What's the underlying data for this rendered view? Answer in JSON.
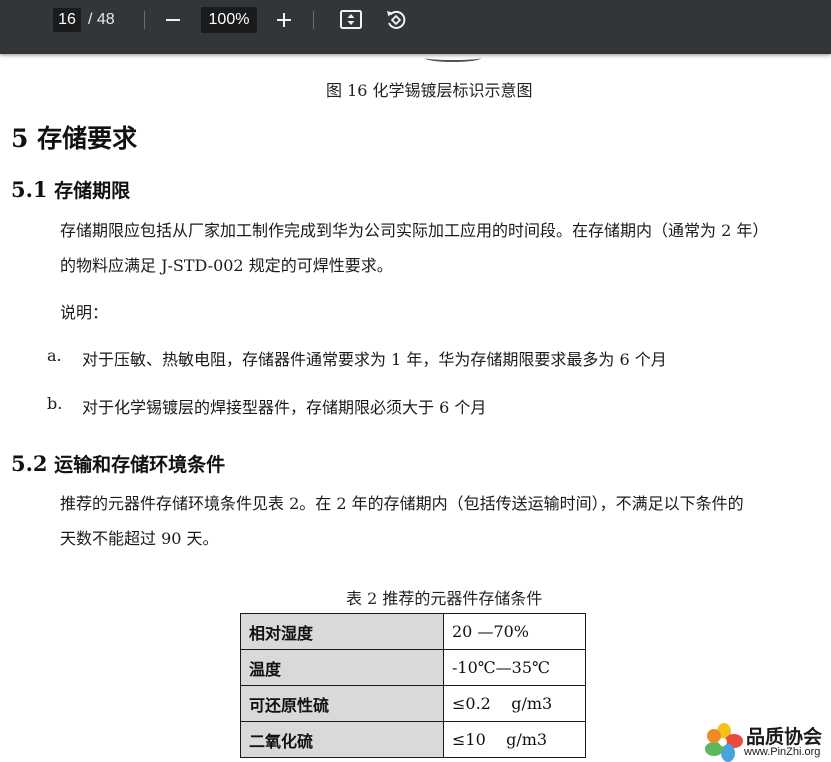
{
  "toolbar": {
    "current_page": "16",
    "total_pages": "/ 48",
    "zoom": "100%",
    "icons": [
      "zoom-out-icon",
      "zoom-in-icon",
      "fit-page-icon",
      "rotate-icon"
    ]
  },
  "document": {
    "figure_caption": "图 16  化学锡镀层标识示意图",
    "section5": {
      "number": "5",
      "title": "存储要求"
    },
    "section5_1": {
      "number": "5.1",
      "title": "存储期限",
      "para_line1": "存储期限应包括从厂家加工制作完成到华为公司实际加工应用的时间段。在存储期内（通常为 2 年）",
      "para_line2": "的物料应满足 J-STD-002 规定的可焊性要求。",
      "note_label": "说明：",
      "items": [
        {
          "marker": "a.",
          "text": "对于压敏、热敏电阻，存储器件通常要求为 1 年，华为存储期限要求最多为 6 个月"
        },
        {
          "marker": "b.",
          "text": "对于化学锡镀层的焊接型器件，存储期限必须大于 6 个月"
        }
      ]
    },
    "section5_2": {
      "number": "5.2",
      "title": "运输和存储环境条件",
      "para_line1": "推荐的元器件存储环境条件见表 2。在 2 年的存储期内（包括传送运输时间），不满足以下条件的",
      "para_line2": "天数不能超过 90 天。"
    },
    "table": {
      "caption": "表 2  推荐的元器件存储条件",
      "rows": [
        {
          "label": "相对湿度",
          "value": "20 —70%"
        },
        {
          "label": "温度",
          "value": "-10℃—35℃"
        },
        {
          "label": "可还原性硫",
          "value": "≤0.2    g/m3"
        },
        {
          "label": "二氧化硫",
          "value": "≤10    g/m3"
        }
      ]
    }
  },
  "watermark": {
    "name": "品质协会",
    "url": "www.PinZhi.org"
  },
  "colors": {
    "toolbar_bg": "#323639",
    "table_label_bg": "#d9d9d9"
  }
}
